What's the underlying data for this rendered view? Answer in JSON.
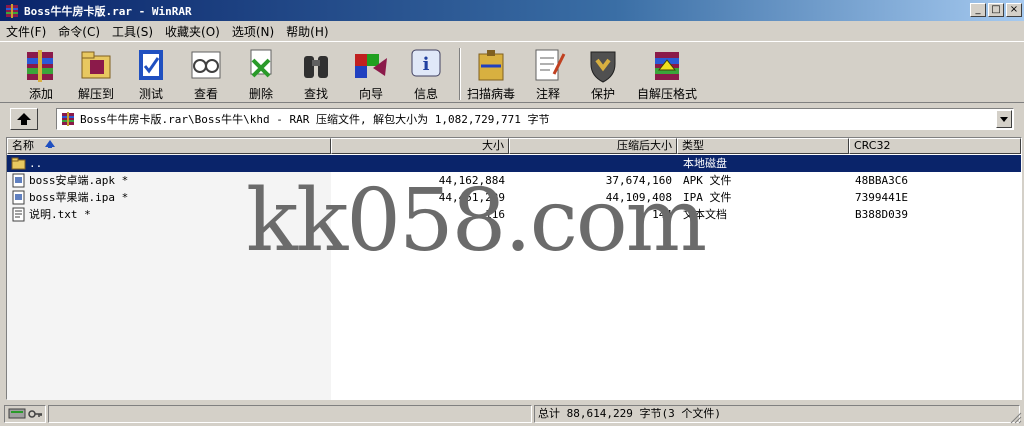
{
  "window": {
    "title": "Boss牛牛房卡版.rar - WinRAR",
    "minimize": "_",
    "maximize": "□",
    "close": "×"
  },
  "menu": [
    "文件(F)",
    "命令(C)",
    "工具(S)",
    "收藏夹(O)",
    "选项(N)",
    "帮助(H)"
  ],
  "toolbar": [
    {
      "label": "添加",
      "icon": "add-archive-icon"
    },
    {
      "label": "解压到",
      "icon": "extract-to-icon"
    },
    {
      "label": "测试",
      "icon": "test-icon"
    },
    {
      "label": "查看",
      "icon": "view-icon"
    },
    {
      "label": "删除",
      "icon": "delete-icon"
    },
    {
      "label": "查找",
      "icon": "find-icon"
    },
    {
      "label": "向导",
      "icon": "wizard-icon"
    },
    {
      "label": "信息",
      "icon": "info-icon"
    },
    {
      "label": "扫描病毒",
      "icon": "virus-scan-icon"
    },
    {
      "label": "注释",
      "icon": "comment-icon"
    },
    {
      "label": "保护",
      "icon": "protect-icon"
    },
    {
      "label": "自解压格式",
      "icon": "sfx-icon"
    }
  ],
  "address": {
    "path": "Boss牛牛房卡版.rar\\Boss牛牛\\khd - RAR 压缩文件, 解包大小为 1,082,729,771 字节"
  },
  "columns": {
    "name": "名称",
    "size": "大小",
    "packed": "压缩后大小",
    "type": "类型",
    "crc": "CRC32"
  },
  "files": [
    {
      "name": "..",
      "size": "",
      "packed": "",
      "type": "本地磁盘",
      "crc": "",
      "icon": "folder-up-icon"
    },
    {
      "name": "boss安卓端.apk *",
      "size": "44,162,884",
      "packed": "37,674,160",
      "type": "APK 文件",
      "crc": "48BBA3C6",
      "icon": "file-icon"
    },
    {
      "name": "boss苹果端.ipa *",
      "size": "44,451,229",
      "packed": "44,109,408",
      "type": "IPA 文件",
      "crc": "7399441E",
      "icon": "file-icon"
    },
    {
      "name": "说明.txt *",
      "size": "116",
      "packed": "144",
      "type": "文本文档",
      "crc": "B388D039",
      "icon": "text-file-icon"
    }
  ],
  "watermark": "kk058.com",
  "status": {
    "summary": "总计 88,614,229 字节(3 个文件)"
  },
  "colors": {
    "selection": "#0a246a",
    "window_bg": "#d4d0c8",
    "title_gradient_start": "#0a246a",
    "title_gradient_end": "#a6caf0"
  }
}
